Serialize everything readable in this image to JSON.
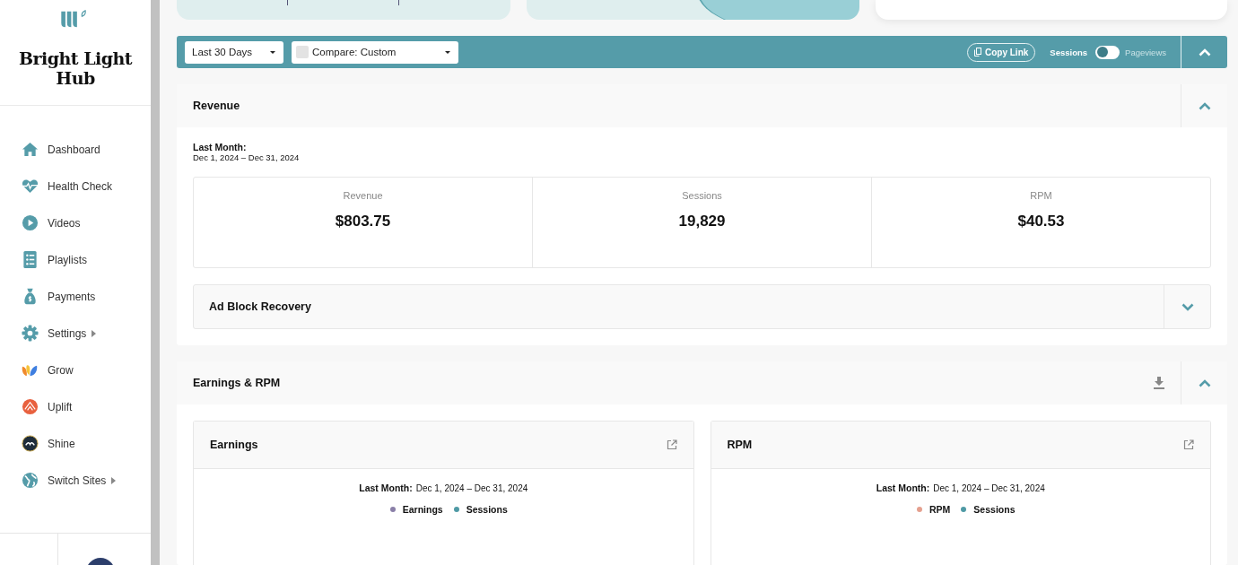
{
  "brand": {
    "name": "Bright Light Hub"
  },
  "nav": [
    {
      "label": "Dashboard",
      "submenu": false
    },
    {
      "label": "Health Check",
      "submenu": false
    },
    {
      "label": "Videos",
      "submenu": false
    },
    {
      "label": "Playlists",
      "submenu": false
    },
    {
      "label": "Payments",
      "submenu": false
    },
    {
      "label": "Settings",
      "submenu": true
    },
    {
      "label": "Grow",
      "submenu": false
    },
    {
      "label": "Uplift",
      "submenu": false
    },
    {
      "label": "Shine",
      "submenu": false
    },
    {
      "label": "Switch Sites",
      "submenu": true
    }
  ],
  "filter_bar": {
    "range": "Last 30 Days",
    "compare": {
      "label": "Compare: Custom",
      "checked": false
    },
    "copy_link": "Copy Link",
    "toggle": {
      "left": "Sessions",
      "right": "Pageviews",
      "on": false
    },
    "expanded": true
  },
  "revenue": {
    "title": "Revenue",
    "expanded": true,
    "period_label": "Last Month:",
    "period": "Dec 1, 2024 – Dec 31, 2024",
    "stats": [
      {
        "label": "Revenue",
        "value": "$803.75"
      },
      {
        "label": "Sessions",
        "value": "19,829"
      },
      {
        "label": "RPM",
        "value": "$40.53"
      }
    ],
    "ad_block": {
      "title": "Ad Block Recovery",
      "expanded": false
    }
  },
  "earnings_rpm": {
    "title": "Earnings & RPM",
    "expanded": true,
    "cards": [
      {
        "title": "Earnings",
        "period_label": "Last Month:",
        "period": "Dec 1, 2024 – Dec 31, 2024",
        "legend": [
          {
            "label": "Earnings",
            "color": "#8a7fa8"
          },
          {
            "label": "Sessions",
            "color": "#4f9aa5"
          }
        ]
      },
      {
        "title": "RPM",
        "period_label": "Last Month:",
        "period": "Dec 1, 2024 – Dec 31, 2024",
        "legend": [
          {
            "label": "RPM",
            "color": "#e5a08f"
          },
          {
            "label": "Sessions",
            "color": "#4f9aa5"
          }
        ]
      }
    ]
  }
}
